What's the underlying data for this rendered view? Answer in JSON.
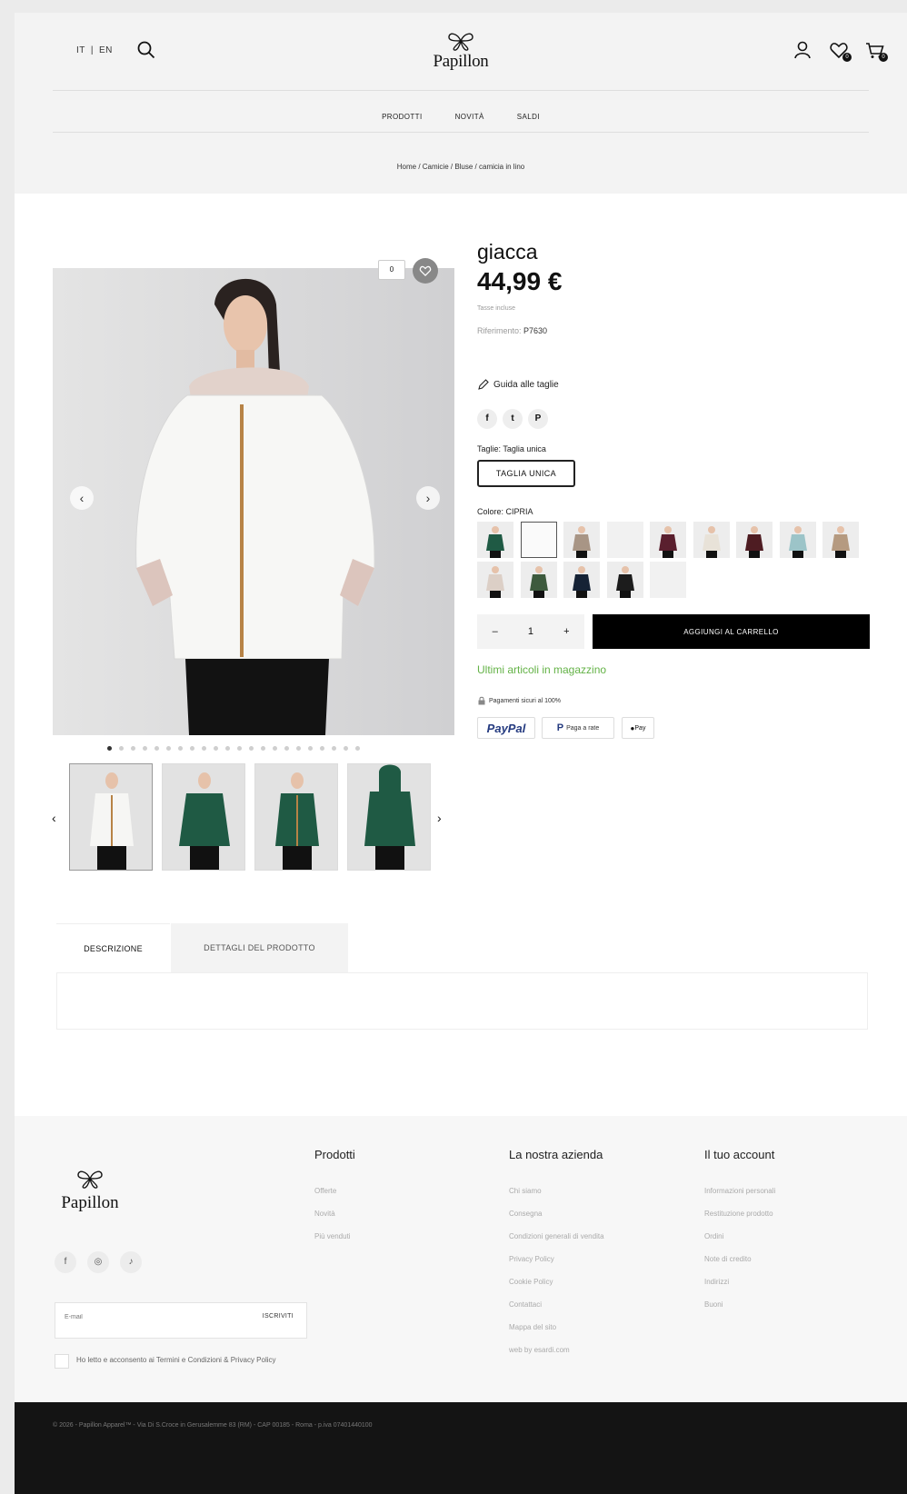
{
  "header": {
    "lang_it": "IT",
    "lang_sep": "|",
    "lang_en": "EN",
    "brand": "Papillon",
    "wishlist_count": "0",
    "cart_count": "0",
    "nav": [
      "PRODOTTI",
      "NOVITÀ",
      "SALDI"
    ],
    "breadcrumb": "Home / Camicie / Bluse / camicia in lino"
  },
  "gallery": {
    "badge": "0",
    "prev": "‹",
    "next": "›",
    "dots_total": 22,
    "dots_active": 0
  },
  "product": {
    "name": "giacca",
    "price": "44,99 €",
    "tax_note": "Tasse incluse",
    "ref_label": "Riferimento:",
    "ref_value": "P7630",
    "size_guide": "Guida alle taglie",
    "size_label": "Taglie: Taglia unica",
    "size_button": "TAGLIA UNICA",
    "color_label": "Colore: CIPRIA",
    "qty_minus": "–",
    "qty_value": "1",
    "qty_plus": "+",
    "add_to_cart": "AGGIUNGI AL CARRELLO",
    "stock_msg": "Ultimi articoli in magazzino",
    "secure_msg": "Pagamenti sicuri al 100%",
    "pay_paypal": "PayPal",
    "pay_rate": "Paga a rate",
    "pay_apple": "Pay"
  },
  "tabs": {
    "description": "DESCRIZIONE",
    "details": "DETTAGLI DEL PRODOTTO"
  },
  "footer": {
    "brand": "Papillon",
    "email_placeholder": "E-mail",
    "subscribe": "ISCRIVITI",
    "agree_text": "Ho letto e acconsento ai Termini e Condizioni & Privacy Policy",
    "col1_title": "Prodotti",
    "col1_items": [
      "Offerte",
      "Novità",
      "Più venduti"
    ],
    "col2_title": "La nostra azienda",
    "col2_items": [
      "Chi siamo",
      "Consegna",
      "Condizioni generali di vendita",
      "Privacy Policy",
      "Cookie Policy",
      "Contattaci",
      "Mappa del sito",
      "web by esardi.com"
    ],
    "col3_title": "Il tuo account",
    "col3_items": [
      "Informazioni personali",
      "Restituzione prodotto",
      "Ordini",
      "Note di credito",
      "Indirizzi",
      "Buoni"
    ],
    "copyright": "© 2026 - Papillon Apparel™ - Via Di S.Croce in Gerusalemme 83 (RM) - CAP 00185 - Roma - p.iva 07401440100"
  },
  "colors": {
    "accent": "#000000",
    "stock_green": "#63b246",
    "header_bg": "#f3f3f3"
  }
}
